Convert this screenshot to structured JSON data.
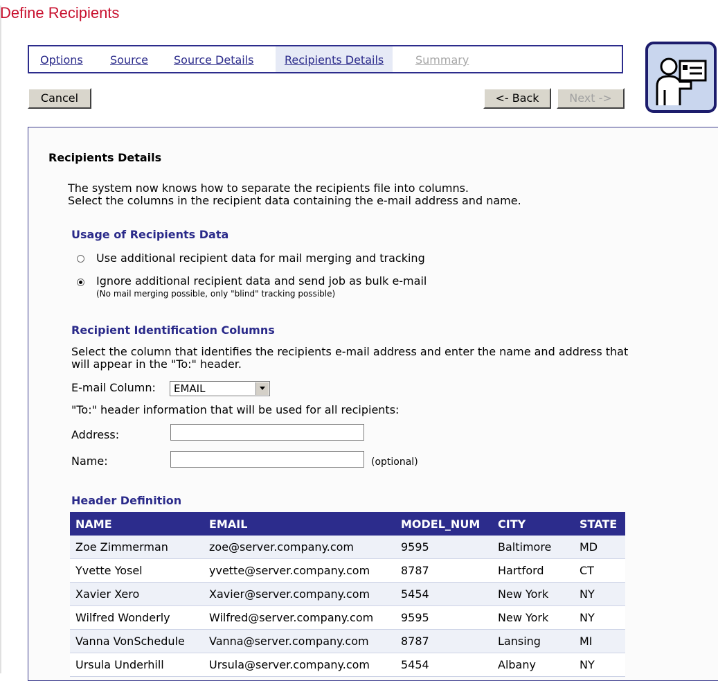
{
  "page": {
    "title": "Define Recipients"
  },
  "tabs": [
    {
      "label": "Options",
      "state": "link"
    },
    {
      "label": "Source",
      "state": "link"
    },
    {
      "label": "Source Details",
      "state": "link"
    },
    {
      "label": "Recipients Details",
      "state": "active"
    },
    {
      "label": "Summary",
      "state": "disabled"
    }
  ],
  "buttons": {
    "cancel": "Cancel",
    "back": "<- Back",
    "next": "Next ->"
  },
  "hero_icon": "user-card-icon",
  "details": {
    "heading": "Recipients Details",
    "intro_line1": "The system now knows how to separate the recipients file into columns.",
    "intro_line2": "Select the columns in the recipient data containing the e-mail address and name."
  },
  "usage": {
    "heading": "Usage of Recipients Data",
    "option1": "Use additional recipient data for mail merging and tracking",
    "option2": "Ignore additional recipient data and send job as bulk e-mail",
    "option2_note": "(No mail merging possible, only \"blind\" tracking possible)",
    "selected": "option2"
  },
  "identification": {
    "heading": "Recipient Identification Columns",
    "desc_line1": "Select the column that identifies the recipients e-mail address and enter the name and address that",
    "desc_line2": "will appear in the \"To:\" header.",
    "email_column_label": "E-mail Column:",
    "email_column_value": "EMAIL",
    "to_header_info": "\"To:\" header information that will be used for all recipients:",
    "address_label": "Address:",
    "address_value": "",
    "name_label": "Name:",
    "name_value": "",
    "optional": "(optional)"
  },
  "header_definition": {
    "heading": "Header Definition",
    "columns": [
      "NAME",
      "EMAIL",
      "MODEL_NUM",
      "CITY",
      "STATE"
    ],
    "rows": [
      [
        "Zoe Zimmerman",
        "zoe@server.company.com",
        "9595",
        "Baltimore",
        "MD"
      ],
      [
        "Yvette Yosel",
        "yvette@server.company.com",
        "8787",
        "Hartford",
        "CT"
      ],
      [
        "Xavier Xero",
        "Xavier@server.company.com",
        "5454",
        "New York",
        "NY"
      ],
      [
        "Wilfred Wonderly",
        "Wilfred@server.company.com",
        "9595",
        "New York",
        "NY"
      ],
      [
        "Vanna VonSchedule",
        "Vanna@server.company.com",
        "8787",
        "Lansing",
        "MI"
      ],
      [
        "Ursula Underhill",
        "Ursula@server.company.com",
        "5454",
        "Albany",
        "NY"
      ]
    ]
  },
  "colors": {
    "title_red": "#c8102e",
    "nav_blue": "#2c2c8c",
    "link_blue": "#2a2a8a",
    "disabled_gray": "#a6a6a6"
  }
}
